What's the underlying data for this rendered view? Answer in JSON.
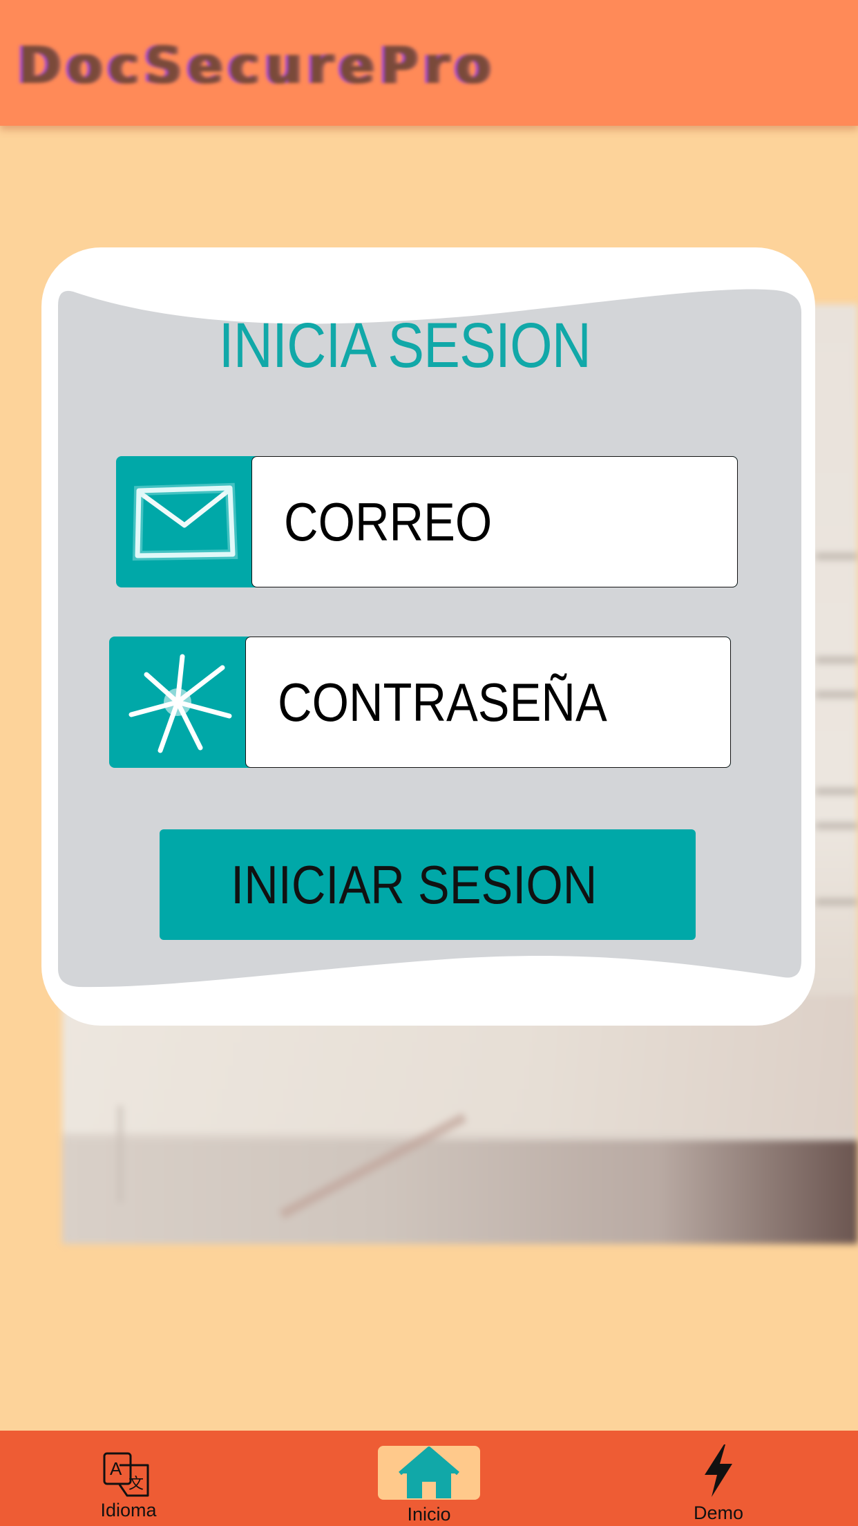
{
  "app": {
    "title": "DocSecurePro"
  },
  "login": {
    "heading": "INICIA SESION",
    "email_placeholder": "CORREO",
    "email_icon": "envelope-icon",
    "password_placeholder": "CONTRASEÑA",
    "password_icon": "asterisk-icon",
    "submit_label": "INICIAR SESION"
  },
  "bottom_nav": {
    "items": [
      {
        "label": "Idioma",
        "icon": "translate-icon",
        "active": false
      },
      {
        "label": "Inicio",
        "icon": "home-icon",
        "active": true
      },
      {
        "label": "Demo",
        "icon": "lightning-icon",
        "active": false
      }
    ]
  },
  "colors": {
    "header": "#FF8A58",
    "background": "#FDD39A",
    "accent": "#00A8A8",
    "title": "#11A8A8",
    "card_panel": "#D3D5D8",
    "bottom_nav": "#EE5C34",
    "nav_active": "#FFC98B"
  }
}
